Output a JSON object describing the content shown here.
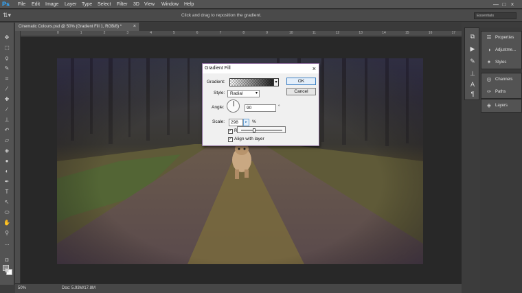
{
  "menubar": {
    "logo": "Ps",
    "items": [
      "File",
      "Edit",
      "Image",
      "Layer",
      "Type",
      "Select",
      "Filter",
      "3D",
      "View",
      "Window",
      "Help"
    ],
    "window_controls": [
      "—",
      "□",
      "×"
    ]
  },
  "options_bar": {
    "tool_glyph": "⇅▾",
    "hint": "Click and drag to reposition the gradient.",
    "workspace": "Essentials"
  },
  "document": {
    "tab_title": "Cinematic Colours.psd @ 50% (Gradient Fill 1, RGB/8) *",
    "tab_close": "×",
    "ruler_ticks": [
      "0",
      "1",
      "2",
      "3",
      "4",
      "5",
      "6",
      "7",
      "8",
      "9",
      "10",
      "11",
      "12",
      "13",
      "14",
      "15",
      "16",
      "17"
    ]
  },
  "status_bar": {
    "zoom": "50%",
    "doc_size": "Doc: 5.93M/17.8M"
  },
  "panels": {
    "groups": [
      {
        "items": [
          {
            "label": "Properties",
            "icon": "properties-icon"
          },
          {
            "label": "Adjustme...",
            "icon": "adjustments-icon"
          },
          {
            "label": "Styles",
            "icon": "styles-icon"
          }
        ]
      },
      {
        "items": [
          {
            "label": "Channels",
            "icon": "channels-icon"
          },
          {
            "label": "Paths",
            "icon": "paths-icon"
          }
        ]
      },
      {
        "items": [
          {
            "label": "Layers",
            "icon": "layers-icon"
          }
        ]
      }
    ]
  },
  "dialog": {
    "title": "Gradient Fill",
    "close": "×",
    "gradient_label": "Gradient:",
    "style_label": "Style:",
    "style_value": "Radial",
    "angle_label": "Angle:",
    "angle_value": "90",
    "angle_unit": "°",
    "scale_label": "Scale:",
    "scale_value": "298",
    "scale_unit": "%",
    "scale_slider_fraction": 0.3,
    "reverse_label": "Re",
    "reverse_checked": true,
    "align_label": "Align with layer",
    "align_checked": true,
    "ok_label": "OK",
    "cancel_label": "Cancel"
  },
  "colors": {
    "accent": "#31a8ff",
    "dialog_border": "#8a6a9a"
  }
}
